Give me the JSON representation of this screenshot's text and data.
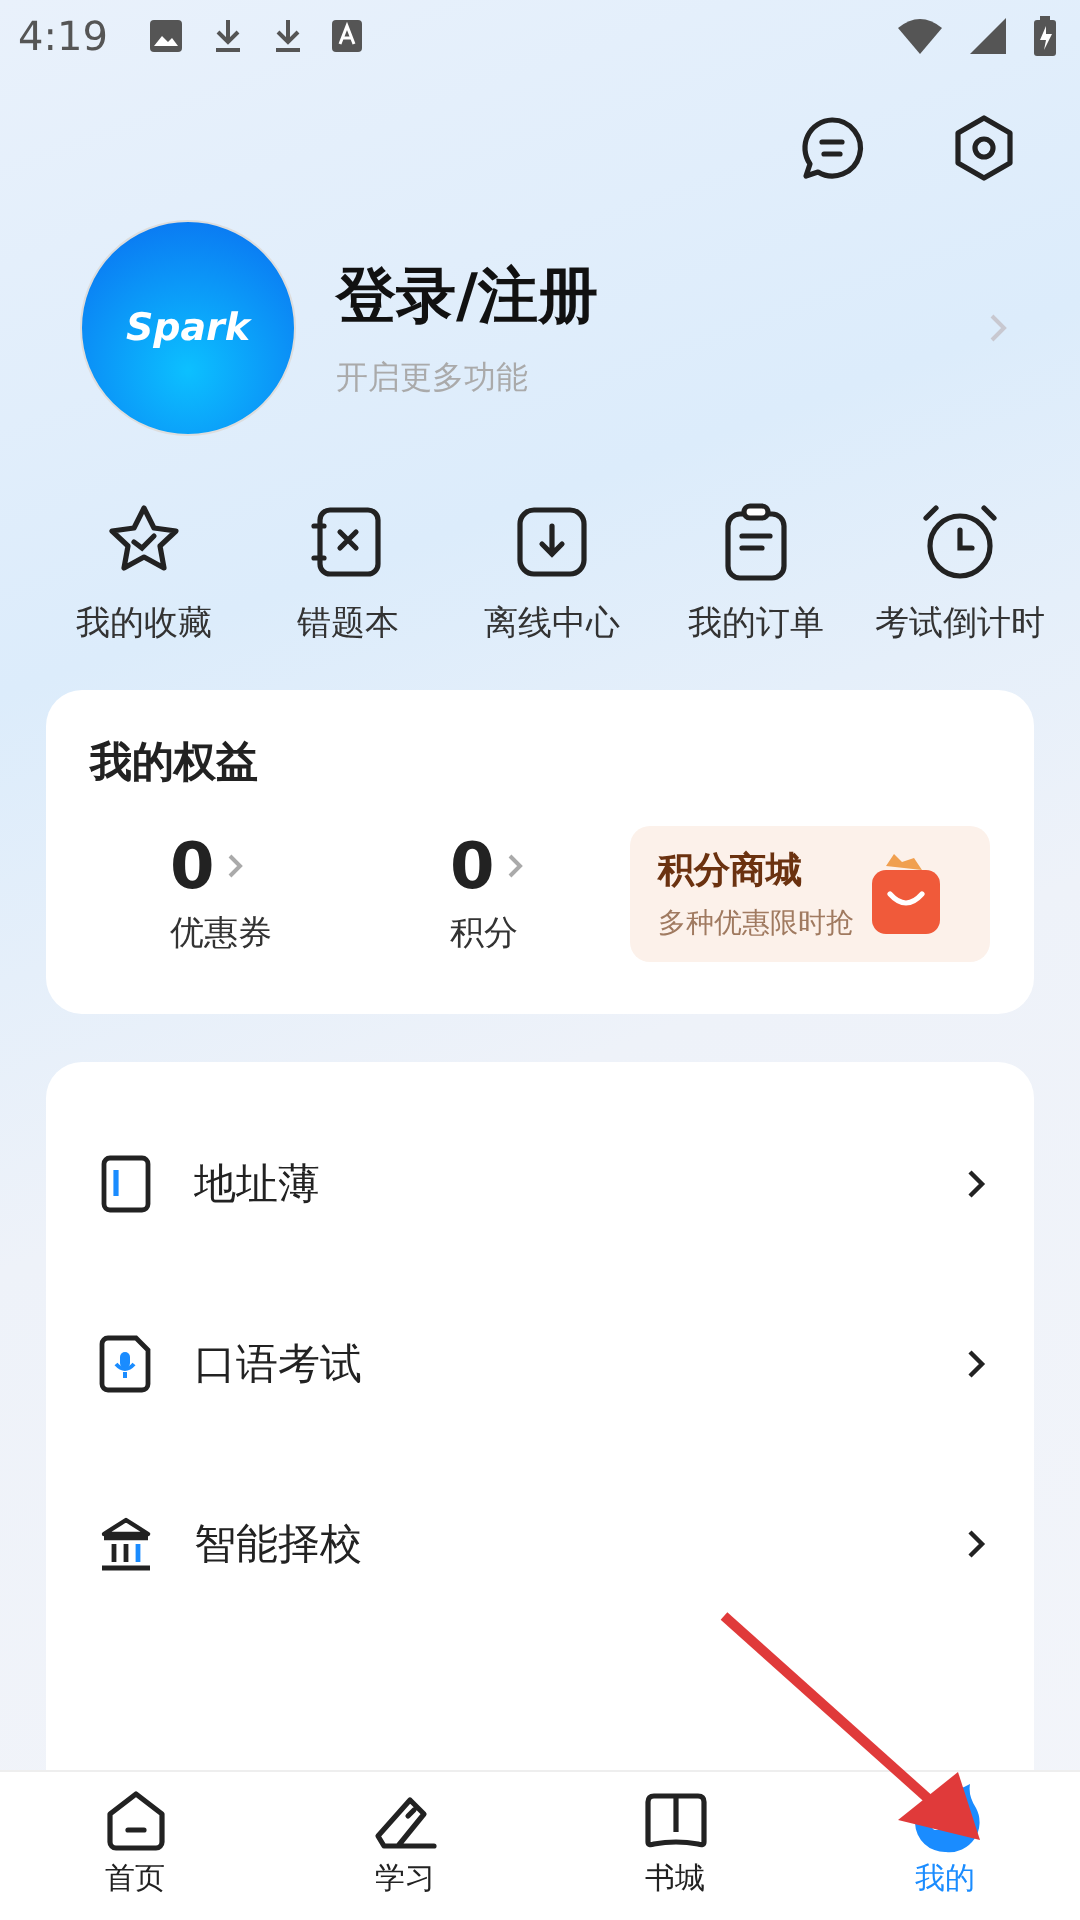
{
  "status_bar": {
    "time": "4:19"
  },
  "profile": {
    "avatar_text": "Spark",
    "name": "登录/注册",
    "subtitle": "开启更多功能"
  },
  "shortcuts": [
    {
      "kind": "star",
      "label": "我的收藏"
    },
    {
      "kind": "mistake",
      "label": "错题本"
    },
    {
      "kind": "download",
      "label": "离线中心"
    },
    {
      "kind": "order",
      "label": "我的订单"
    },
    {
      "kind": "alarm",
      "label": "考试倒计时"
    }
  ],
  "benefits": {
    "title": "我的权益",
    "stats": [
      {
        "value": "0",
        "label": "优惠券"
      },
      {
        "value": "0",
        "label": "积分"
      }
    ],
    "promo": {
      "title": "积分商城",
      "subtitle": "多种优惠限时抢"
    }
  },
  "menu": [
    {
      "kind": "address",
      "label": "地址薄"
    },
    {
      "kind": "speaking",
      "label": "口语考试"
    },
    {
      "kind": "school",
      "label": "智能择校"
    }
  ],
  "nav": [
    {
      "kind": "home",
      "label": "首页",
      "selected": false
    },
    {
      "kind": "study",
      "label": "学习",
      "selected": false
    },
    {
      "kind": "book",
      "label": "书城",
      "selected": false
    },
    {
      "kind": "me",
      "label": "我的",
      "selected": true
    }
  ]
}
